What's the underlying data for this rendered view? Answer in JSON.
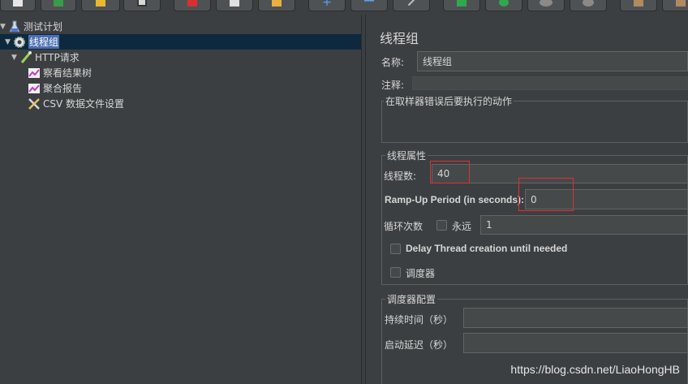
{
  "toolbar": {
    "buttons": [
      "new-icon",
      "templates-icon",
      "open-icon",
      "save-icon",
      "cut-icon",
      "copy-icon",
      "paste-icon",
      "expand-icon",
      "collapse-icon",
      "toggle-icon",
      "start-icon",
      "start-no-pause-icon",
      "stop-icon",
      "shutdown-icon",
      "clear-icon",
      "clear-all-icon"
    ]
  },
  "tree": {
    "items": [
      {
        "label": "测试计划",
        "icon": "test-plan-icon"
      },
      {
        "label": "线程组",
        "icon": "thread-group-gear-icon"
      },
      {
        "label": "HTTP请求",
        "icon": "http-sampler-icon"
      },
      {
        "label": "察看结果树",
        "icon": "listener-icon"
      },
      {
        "label": "聚合报告",
        "icon": "listener-icon"
      },
      {
        "label": "CSV 数据文件设置",
        "icon": "config-tools-icon"
      }
    ]
  },
  "panel": {
    "title": "线程组",
    "name_label": "名称:",
    "name_value": "线程组",
    "comment_label": "注释:",
    "comment_value": "",
    "error_action_title": "在取样器错误后要执行的动作",
    "thread_props_title": "线程属性",
    "threads_label": "线程数:",
    "threads_value": "40",
    "rampup_label": "Ramp-Up Period (in seconds):",
    "rampup_value": "0",
    "loop_label": "循环次数",
    "forever_label": "永远",
    "loop_value": "1",
    "delay_label": "Delay Thread creation until needed",
    "scheduler_label": "调度器",
    "scheduler_config_title": "调度器配置",
    "duration_label": "持续时间（秒）",
    "duration_value": "",
    "startup_delay_label": "启动延迟（秒）",
    "startup_delay_value": ""
  },
  "watermark": "https://blog.csdn.net/LiaoHongHB",
  "colors": {
    "background": "#3c3f41",
    "selection": "#4b6eaf",
    "highlight_box": "#e03030",
    "field_bg": "#45494a"
  }
}
